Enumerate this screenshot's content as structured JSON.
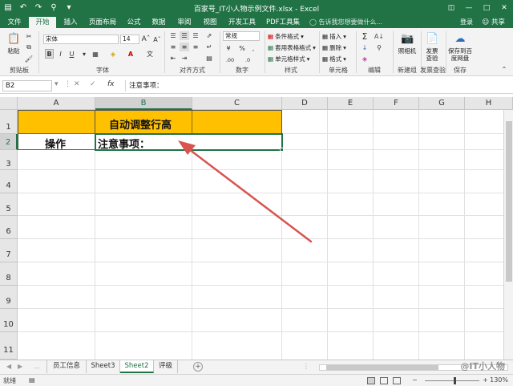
{
  "window": {
    "title": "百家号_IT小人物示例文件.xlsx - Excel",
    "controls": [
      "restore-icon",
      "minimize-icon",
      "maximize-icon",
      "close-icon"
    ]
  },
  "tabs": [
    "文件",
    "开始",
    "插入",
    "页面布局",
    "公式",
    "数据",
    "审阅",
    "视图",
    "开发工具",
    "PDF工具集"
  ],
  "active_tab": "开始",
  "tell_me": "告诉我您想要做什么...",
  "login": "登录",
  "share": "共享",
  "ribbon": {
    "clipboard": {
      "paste": "粘贴",
      "label": "剪贴板"
    },
    "font": {
      "name": "宋体",
      "size": "14",
      "label": "字体",
      "bold": "B",
      "italic": "I",
      "underline": "U"
    },
    "alignment": {
      "label": "对齐方式"
    },
    "number": {
      "format": "常规",
      "label": "数字"
    },
    "styles": {
      "conditional": "条件格式",
      "table": "套用表格格式",
      "cell": "单元格样式",
      "label": "样式"
    },
    "cells": {
      "insert": "插入",
      "delete": "删除",
      "format": "格式",
      "label": "单元格"
    },
    "editing": {
      "label": "编辑"
    },
    "newgroup": {
      "camera": "照相机",
      "label": "新建组"
    },
    "invoice": {
      "check": "发票查验",
      "label": "发票查验"
    },
    "save": {
      "save_to": "保存到百度网盘",
      "label": "保存"
    }
  },
  "formula_bar": {
    "name_box": "B2",
    "content": "注意事项："
  },
  "columns": [
    "A",
    "B",
    "C",
    "D",
    "E",
    "F",
    "G",
    "H"
  ],
  "rows": [
    "1",
    "2",
    "3",
    "4",
    "5",
    "6",
    "7",
    "8",
    "9",
    "10",
    "11"
  ],
  "cells": {
    "B1": "自动调整行高",
    "A2": "操作",
    "B2": "注意事项："
  },
  "colors": {
    "accent": "#217346",
    "highlight": "#ffc000",
    "arrow": "#d9534f"
  },
  "sheets": [
    "员工信息",
    "Sheet3",
    "Sheet2",
    "评级"
  ],
  "active_sheet": "Sheet2",
  "status": {
    "mode": "就绪",
    "zoom": "130%"
  },
  "watermark": "@IT小人物"
}
